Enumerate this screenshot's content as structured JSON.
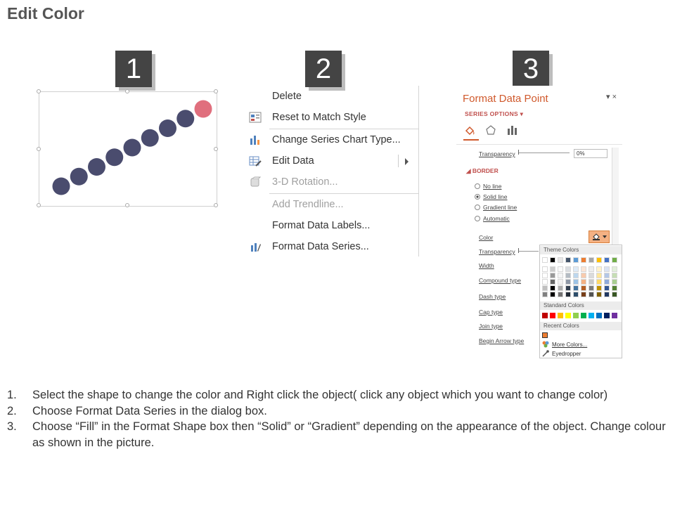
{
  "page": {
    "title": "Edit Color"
  },
  "badges": [
    "1",
    "2",
    "3"
  ],
  "context_menu": {
    "items": [
      {
        "label": "Delete",
        "icon": "none",
        "disabled": false
      },
      {
        "label": "Reset to Match Style",
        "icon": "reset-style-icon",
        "disabled": false
      },
      {
        "label": "Change Series Chart Type...",
        "icon": "bar-chart-icon",
        "disabled": false
      },
      {
        "label": "Edit Data",
        "icon": "edit-data-icon",
        "disabled": false,
        "submenu": true
      },
      {
        "label": "3-D Rotation...",
        "icon": "3d-rotation-icon",
        "disabled": true
      },
      {
        "label": "Add Trendline...",
        "icon": "none",
        "disabled": true
      },
      {
        "label": "Format Data Labels...",
        "icon": "none",
        "disabled": false
      },
      {
        "label": "Format Data Series...",
        "icon": "format-series-icon",
        "disabled": false
      }
    ]
  },
  "format_pane": {
    "title": "Format Data Point",
    "close": "▾ ×",
    "series_options": "SERIES OPTIONS ▾",
    "tabs": [
      "fill-line-icon",
      "pentagon-icon",
      "bar-chart-icon"
    ],
    "transparency_label": "Transparency",
    "transparency_value": "0%",
    "border_header": "◢ BORDER",
    "radios": [
      {
        "label": "No line",
        "selected": false
      },
      {
        "label": "Solid line",
        "selected": true
      },
      {
        "label": "Gradient line",
        "selected": false
      },
      {
        "label": "Automatic",
        "selected": false
      }
    ],
    "color_label": "Color",
    "lower_rows": [
      "Transparency",
      "Width",
      "Compound type",
      "Dash type",
      "Cap type",
      "Join type",
      "Begin Arrow type"
    ],
    "palette": {
      "theme_header": "Theme Colors",
      "standard_header": "Standard Colors",
      "recent_header": "Recent Colors",
      "more_colors": "More Colors...",
      "eyedropper": "Eyedropper",
      "theme_top": [
        "#ffffff",
        "#000000",
        "#e7e6e6",
        "#44546a",
        "#5b9bd5",
        "#ed7d31",
        "#a5a5a5",
        "#ffc000",
        "#4472c4",
        "#70ad47"
      ],
      "standard": [
        "#c00000",
        "#ff0000",
        "#ffc000",
        "#ffff00",
        "#92d050",
        "#00b050",
        "#00b0f0",
        "#0070c0",
        "#002060",
        "#7030a0"
      ],
      "recent": [
        "#ed7d31"
      ]
    }
  },
  "chart": {
    "dot_color": "#4a4c6e",
    "highlight_color": "#e06f7d"
  },
  "instructions": [
    {
      "num": "1.",
      "text": "Select the shape to change the color and Right click the object( click any object which you want to change color)"
    },
    {
      "num": "2.",
      "text": "Choose Format Data Series in the dialog box."
    },
    {
      "num": "3.",
      "text": "Choose “Fill” in the Format Shape box then “Solid” or “Gradient” depending on the appearance of the object. Change colour as shown in the picture."
    }
  ]
}
